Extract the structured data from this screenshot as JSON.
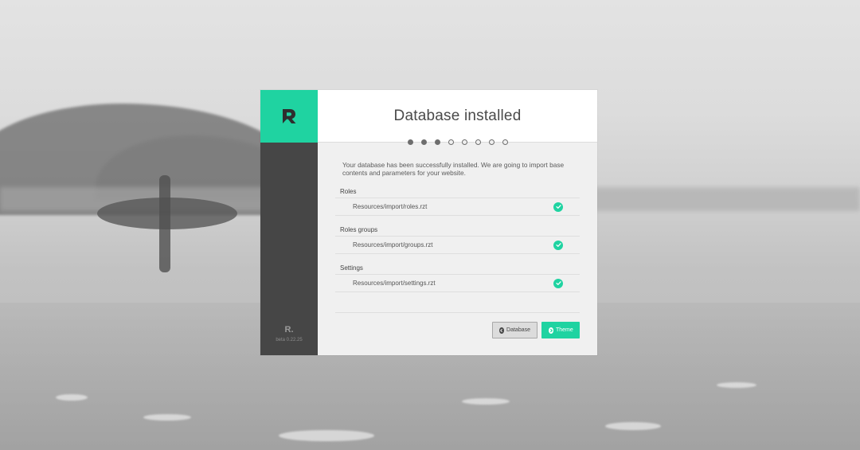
{
  "brand": {
    "logo_letter": "R",
    "mini_logo": "R.",
    "version": "beta 0.22.25",
    "accent_color": "#1fd3a1",
    "sidebar_color": "#464646"
  },
  "page": {
    "title": "Database installed",
    "intro": "Your database has been successfully installed. We are going to import base contents and parameters for your website."
  },
  "steps": {
    "total": 8,
    "completed": 3
  },
  "imports": [
    {
      "label": "Roles",
      "path": "Resources/import/roles.rzt",
      "status_icon": "check-circle-icon"
    },
    {
      "label": "Roles groups",
      "path": "Resources/import/groups.rzt",
      "status_icon": "check-circle-icon"
    },
    {
      "label": "Settings",
      "path": "Resources/import/settings.rzt",
      "status_icon": "check-circle-icon"
    }
  ],
  "buttons": {
    "back_label": "Database",
    "back_icon": "arrow-left-circle-icon",
    "next_label": "Theme",
    "next_icon": "arrow-right-circle-icon"
  }
}
